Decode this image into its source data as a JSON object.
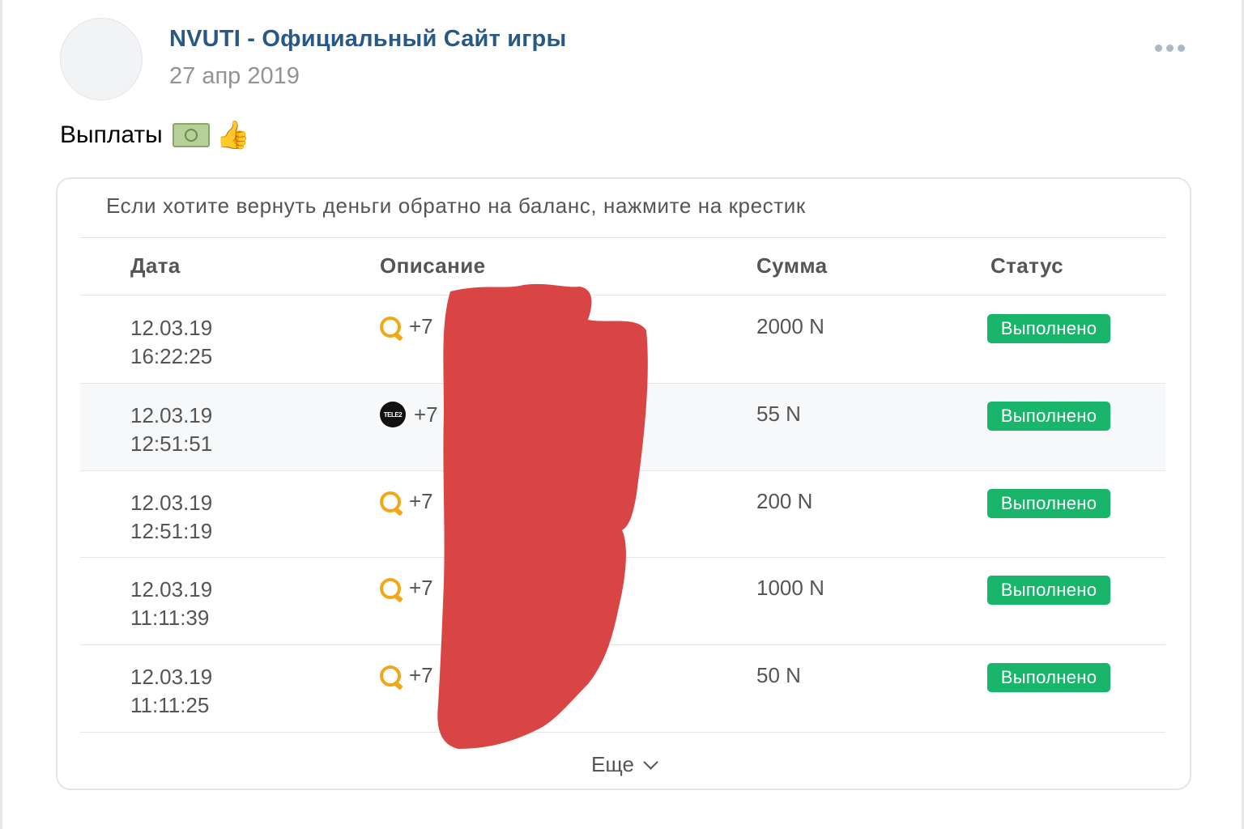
{
  "post": {
    "author": "NVUTI - Официальный Сайт игры",
    "date": "27 апр 2019",
    "text": "Выплаты",
    "emoji": [
      "money-icon",
      "thumbs-up-icon"
    ]
  },
  "table": {
    "notice": "Если хотите вернуть деньги обратно на баланс, нажмите на крестик",
    "headers": {
      "date": "Дата",
      "description": "Описание",
      "sum": "Сумма",
      "status": "Статус"
    },
    "rows": [
      {
        "date": "12.03.19",
        "time": "16:22:25",
        "icon": "qiwi-icon",
        "desc": "+7",
        "sum": "2000 N",
        "status": "Выполнено"
      },
      {
        "date": "12.03.19",
        "time": "12:51:51",
        "icon": "tele2-icon",
        "desc": "+7",
        "sum": "55 N",
        "status": "Выполнено"
      },
      {
        "date": "12.03.19",
        "time": "12:51:19",
        "icon": "qiwi-icon",
        "desc": "+7",
        "sum": "200 N",
        "status": "Выполнено"
      },
      {
        "date": "12.03.19",
        "time": "11:11:39",
        "icon": "qiwi-icon",
        "desc": "+7",
        "sum": "1000 N",
        "status": "Выполнено"
      },
      {
        "date": "12.03.19",
        "time": "11:11:25",
        "icon": "qiwi-icon",
        "desc": "+7",
        "sum": "50 N",
        "status": "Выполнено"
      }
    ],
    "more_label": "Еще",
    "tele2_label": "TELE2"
  },
  "colors": {
    "author": "#2a5885",
    "status_green": "#19b56b",
    "redaction": "#d94545",
    "qiwi": "#f0a818"
  }
}
